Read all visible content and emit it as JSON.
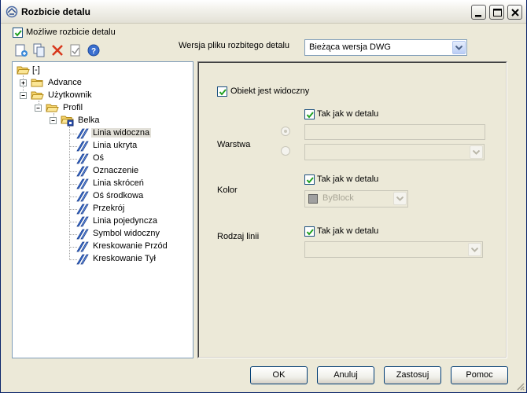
{
  "window": {
    "title": "Rozbicie detalu",
    "title_icon": "detail-app-icon"
  },
  "top": {
    "possible_breakup_label": "Możliwe rozbicie detalu",
    "possible_breakup_checked": true,
    "file_version_label": "Wersja pliku rozbitego detalu",
    "file_version_value": "Bieżąca wersja DWG"
  },
  "toolbar": {
    "icons": [
      "new-icon",
      "copy-icon",
      "delete-icon",
      "properties-icon",
      "help-icon"
    ]
  },
  "tree": {
    "root": "[-]",
    "advance": "Advance",
    "user": "Użytkownik",
    "profil": "Profil",
    "belka": "Belka",
    "items": [
      "Linia widoczna",
      "Linia ukryta",
      "Oś",
      "Oznaczenie",
      "Linia skróceń",
      "Oś środkowa",
      "Przekrój",
      "Linia pojedyncza",
      "Symbol widoczny",
      "Kreskowanie Przód",
      "Kreskowanie Tył"
    ],
    "selected_index": 0
  },
  "panel": {
    "visible_label": "Obiekt jest widoczny",
    "visible_checked": true,
    "layer": {
      "label": "Warstwa",
      "as_in_detail_label": "Tak jak w detalu",
      "checked": true
    },
    "color": {
      "label": "Kolor",
      "as_in_detail_label": "Tak jak w detalu",
      "checked": true,
      "value": "ByBlock"
    },
    "linetype": {
      "label": "Rodzaj linii",
      "as_in_detail_label": "Tak jak w detalu",
      "checked": true
    }
  },
  "buttons": {
    "ok": "OK",
    "cancel": "Anuluj",
    "apply": "Zastosuj",
    "help": "Pomoc"
  }
}
